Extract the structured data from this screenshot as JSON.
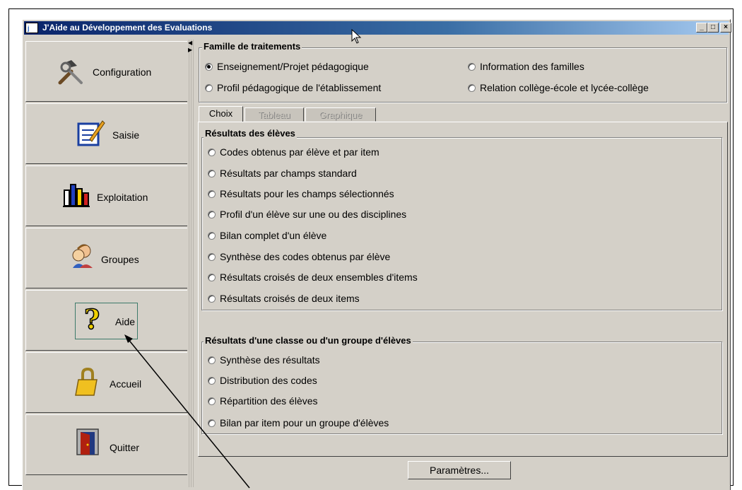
{
  "window": {
    "icon_text": "j",
    "title": "J'Aide au Développement des Evaluations",
    "caption_buttons": [
      "minimize",
      "maximize",
      "close"
    ]
  },
  "nav": {
    "items": [
      {
        "label": "Configuration",
        "icon": "tools-icon"
      },
      {
        "label": "Saisie",
        "icon": "notepad-icon"
      },
      {
        "label": "Exploitation",
        "icon": "bar-chart-icon"
      },
      {
        "label": "Groupes",
        "icon": "people-icon"
      },
      {
        "label": "Aide",
        "icon": "question-mark-icon"
      },
      {
        "label": "Accueil",
        "icon": "padlock-icon"
      },
      {
        "label": "Quitter",
        "icon": "door-icon"
      }
    ]
  },
  "famille": {
    "title": "Famille de traitements",
    "options": [
      {
        "label": "Enseignement/Projet pédagogique",
        "selected": true
      },
      {
        "label": "Information des familles",
        "selected": false
      },
      {
        "label": "Profil pédagogique de l'établissement",
        "selected": false
      },
      {
        "label": "Relation collège-école et lycée-collège",
        "selected": false
      }
    ]
  },
  "tabs": [
    {
      "label": "Choix",
      "enabled": true
    },
    {
      "label": "Tableau",
      "enabled": false
    },
    {
      "label": "Graphique",
      "enabled": false
    }
  ],
  "eleves": {
    "title": "Résultats des élèves",
    "options": [
      "Codes obtenus par élève et par item",
      "Résultats par champs standard",
      "Résultats pour les champs sélectionnés",
      "Profil d'un élève sur une ou des disciplines",
      "Bilan complet d'un élève",
      "Synthèse des codes obtenus par élève",
      "Résultats croisés de deux ensembles d'items",
      "Résultats croisés de deux items"
    ]
  },
  "classe": {
    "title": "Résultats d'une classe ou d'un groupe d'élèves",
    "options": [
      "Synthèse des résultats",
      "Distribution des codes",
      "Répartition des élèves",
      "Bilan par item pour un groupe d'élèves"
    ]
  },
  "footer": {
    "parametres_label": "Paramètres..."
  }
}
